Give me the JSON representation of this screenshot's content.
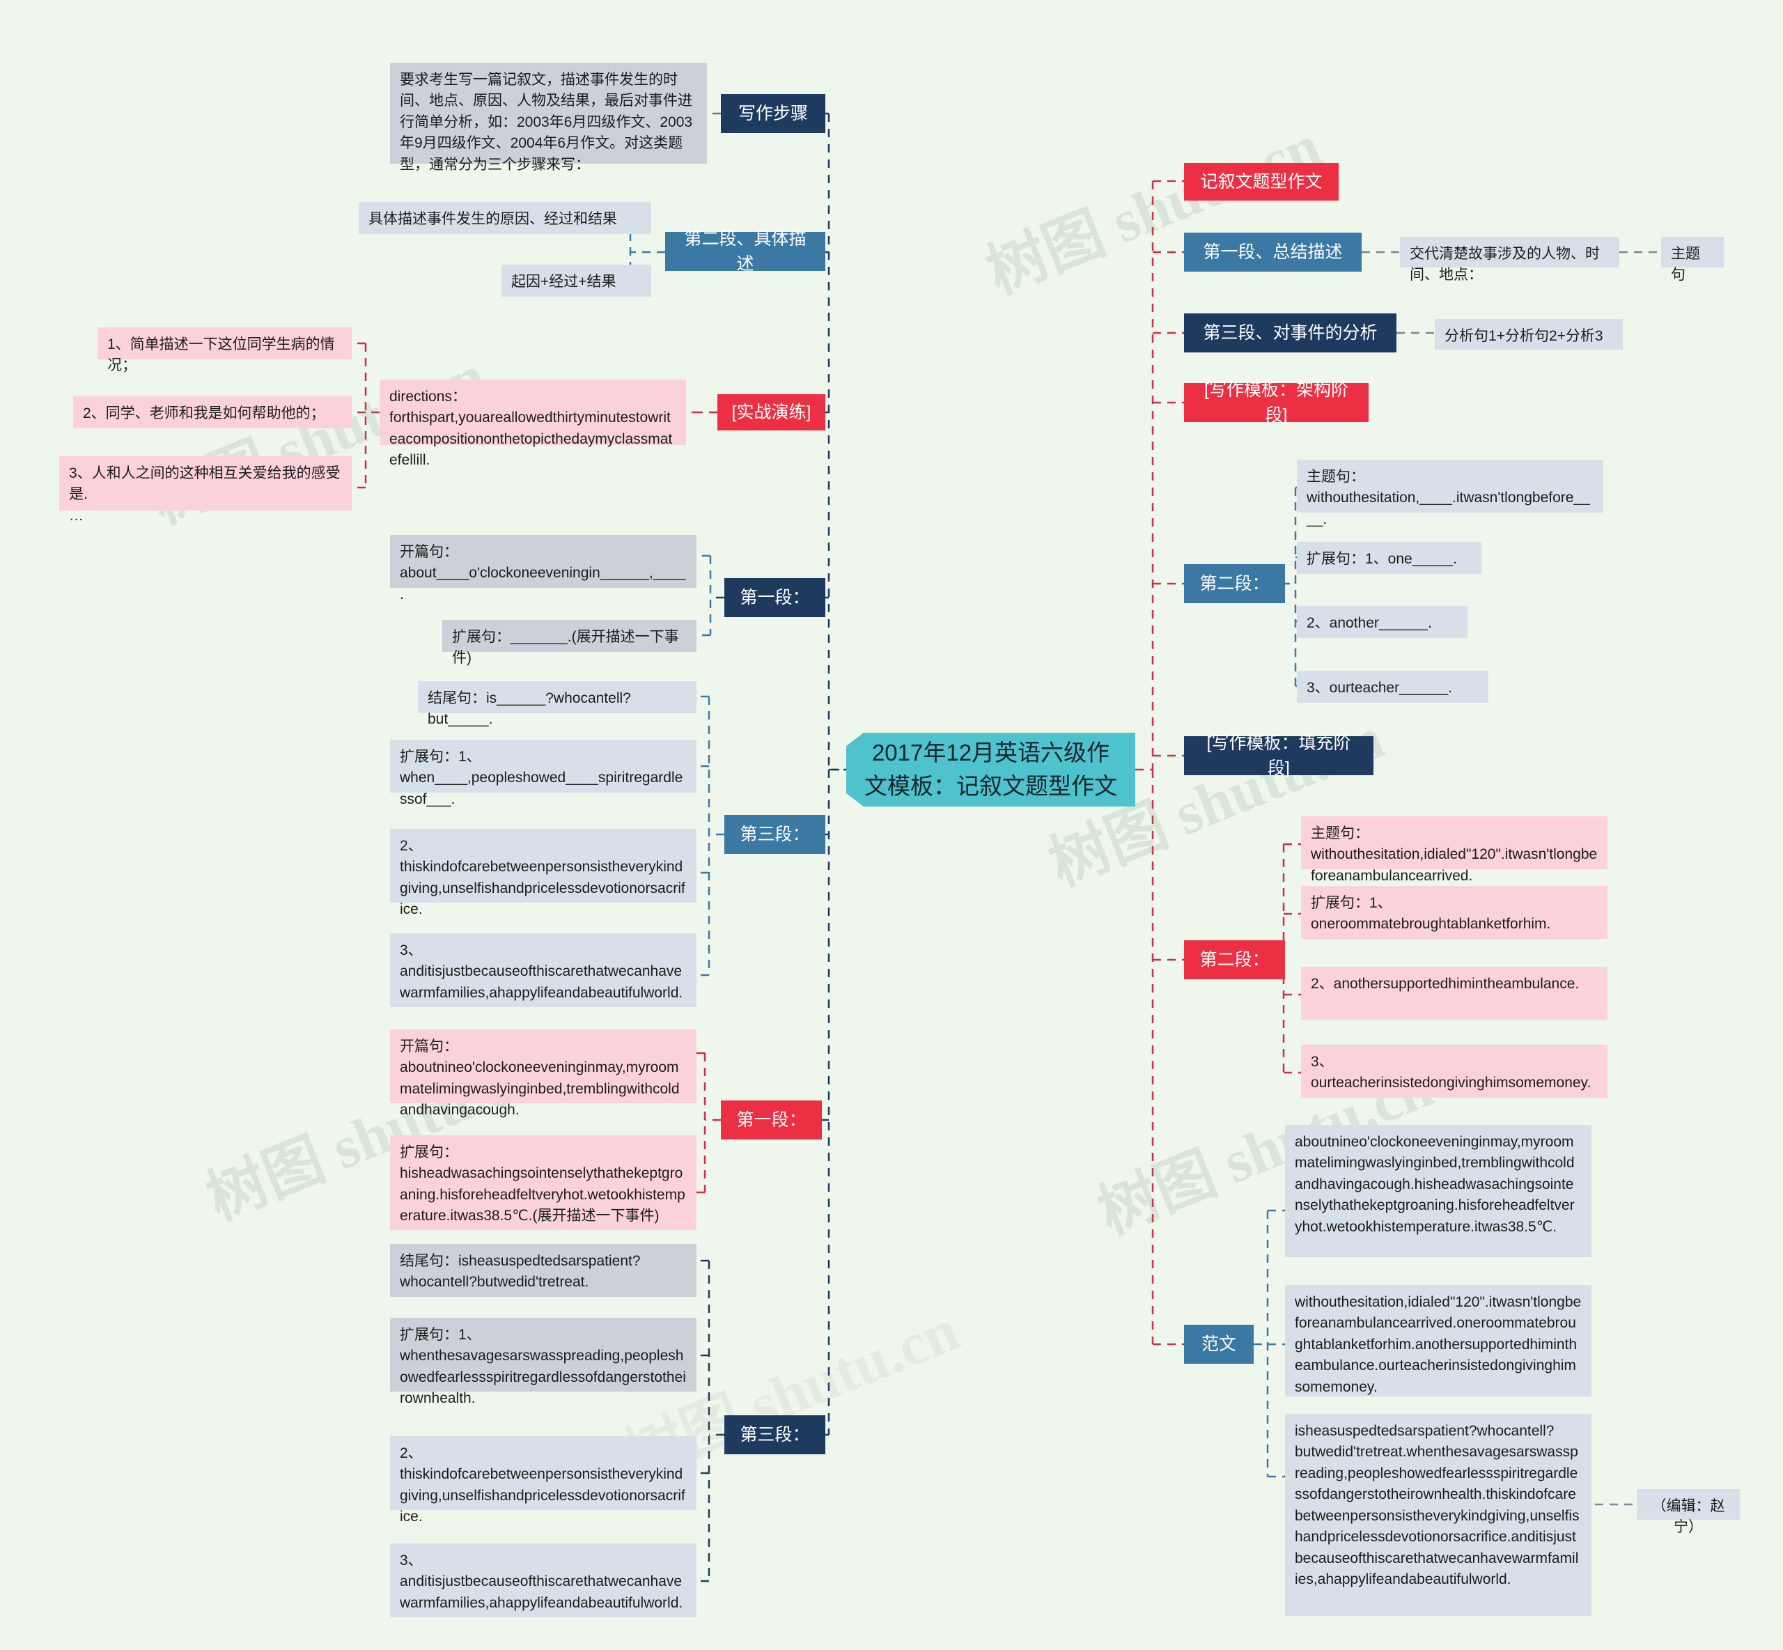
{
  "root": {
    "title": "2017年12月英语六级作文模板：记叙文题型作文",
    "color": "#4ec3cd"
  },
  "palette": {
    "navy": "#1f3a5f",
    "blue": "#3b78a4",
    "red": "#ec2f42",
    "leaf_gray": "#d7dfe8",
    "leaf_gray2": "#ccd1d9",
    "leaf_pink": "#fbd2da",
    "background": "#eff7ec"
  },
  "watermark": {
    "text": "树图 shutu.cn"
  },
  "left": {
    "branches": [
      {
        "label": "写作步骤",
        "style": "navy"
      },
      {
        "label": "第二段、具体描述",
        "style": "blue"
      },
      {
        "label": "[实战演练]",
        "style": "red"
      },
      {
        "label": "第一段：",
        "style": "navy"
      },
      {
        "label": "第三段：",
        "style": "blue"
      },
      {
        "label": "第一段：",
        "style": "red"
      },
      {
        "label": "第三段：",
        "style": "navy"
      }
    ],
    "leaves": {
      "intro": "要求考生写一篇记叙文，描述事件发生的时间、地点、原因、人物及结果，最后对事件进行简单分析，如：2003年6月四级作文、2003年9月四级作文、2004年6月作文。对这类题型，通常分为三个步骤来写：",
      "para2_desc": "具体描述事件发生的原因、经过和结果",
      "para2_formula": "起因+经过+结果",
      "drill1": "1、简单描述一下这位同学生病的情况；",
      "drill2": "2、同学、老师和我是如何帮助他的；",
      "drill3": "3、人和人之间的这种相互关爱给我的感受是.\n…",
      "directions": "directions：forthispart,youareallowedthirtyminutestowriteacompositiononthetopicthedaymyclassmatefellill.",
      "p1_open_blank": "开篇句：about____o'clockoneeveningin______,____.",
      "p1_expand_blank": "扩展句：_______.(展开描述一下事件)",
      "p3_end_blank": "结尾句：is______?whocantell?but_____.",
      "p3_exp1_blank": "扩展句：1、when____,peopleshowed____spiritregardlessof___.",
      "p3_exp2_blank": "2、thiskindofcarebetweenpersonsistheverykindgiving,unselfishandpricelessdevotionorsacrifice.",
      "p3_exp3_blank": "3、anditisjustbecauseofthiscarethatwecanhavewarmfamilies,ahappylifeandabeautifulworld.",
      "p1_open_filled": "开篇句：aboutnineo'clockoneeveninginmay,myroommatelimingwaslyinginbed,tremblingwithcoldandhavingacough.",
      "p1_expand_filled": "扩展句：hisheadwasachingsointenselythathekeptgroaning.hisforeheadfeltveryhot.wetookhistemperature.itwas38.5℃.(展开描述一下事件)",
      "p3_end_filled": "结尾句：isheasuspedtedsarspatient?whocantell?butwedid'tretreat.",
      "p3_exp1_filled": "扩展句：1、whenthesavagesarswasspreading,peopleshowedfearlessspiritregardlessofdangerstotheirownhealth.",
      "p3_exp2_filled": "2、thiskindofcarebetweenpersonsistheverykindgiving,unselfishandpricelessdevotionorsacrifice.",
      "p3_exp3_filled": "3、anditisjustbecauseofthiscarethatwecanhavewarmfamilies,ahappylifeandabeautifulworld."
    }
  },
  "right": {
    "branches": [
      {
        "label": "记叙文题型作文",
        "style": "red"
      },
      {
        "label": "第一段、总结描述",
        "style": "blue"
      },
      {
        "label": "第三段、对事件的分析",
        "style": "navy"
      },
      {
        "label": "[写作模板：架构阶段]",
        "style": "red"
      },
      {
        "label": "第二段：",
        "style": "blue"
      },
      {
        "label": "[写作模板：填充阶段]",
        "style": "navy"
      },
      {
        "label": "第二段：",
        "style": "red"
      },
      {
        "label": "范文",
        "style": "blue"
      }
    ],
    "leaves": {
      "p1_summary": "交代清楚故事涉及的人物、时间、地点：",
      "p1_topic": "主题句",
      "p3_analysis": "分析句1+分析句2+分析3",
      "p2_topic_blank": "主题句：withouthesitation,____.itwasn'tlongbefore____.",
      "p2_exp1_blank": "扩展句：1、one_____.",
      "p2_exp2_blank": "2、another______.",
      "p2_exp3_blank": "3、ourteacher______.",
      "p2_topic_filled": "主题句：withouthesitation,idialed\"120\".itwasn'tlongbeforeanambulancearrived.",
      "p2_exp1_filled": "扩展句：1、oneroommatebroughtablanketforhim.",
      "p2_exp2_filled": "2、anothersupportedhimintheambulance.",
      "p2_exp3_filled": "3、ourteacherinsistedongivinghimsomemoney.",
      "essay_p1": "aboutnineo'clockoneeveninginmay,myroommatelimingwaslyinginbed,tremblingwithcoldandhavingacough.hisheadwasachingsointenselythathekeptgroaning.hisforeheadfeltveryhot.wetookhistemperature.itwas38.5℃.",
      "essay_p2": "withouthesitation,idialed\"120\".itwasn'tlongbeforeanambulancearrived.oneroommatebroughtablanketforhim.anothersupportedhimintheambulance.ourteacherinsistedongivinghimsomemoney.",
      "essay_p3": "isheasuspedtedsarspatient?whocantell?butwedid'tretreat.whenthesavagesarswasspreading,peopleshowedfearlessspiritregardlessofdangerstotheirownhealth.thiskindofcarebetweenpersonsistheverykindgiving,unselfishandpricelessdevotionorsacrifice.anditisjustbecauseofthiscarethatwecanhavewarmfamilies,ahappylifeandabeautifulworld.",
      "editor": "（编辑：赵宁）"
    }
  }
}
